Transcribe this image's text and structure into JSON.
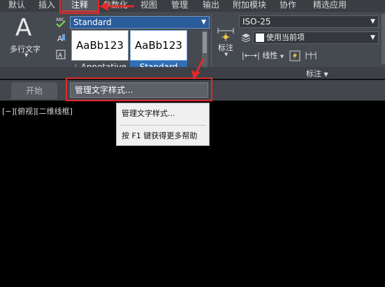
{
  "menubar": {
    "items": [
      "默认",
      "插入",
      "注释",
      "参数化",
      "视图",
      "管理",
      "输出",
      "附加模块",
      "协作",
      "精选应用"
    ],
    "active_index": 2
  },
  "ribbon": {
    "multiline_text_label": "多行文字",
    "text_style_selected": "Standard",
    "text_style_swatches": [
      {
        "preview": "AaBb123",
        "name": "Annotative"
      },
      {
        "preview": "AaBb123",
        "name": "Standard"
      }
    ],
    "dimension_label": "标注",
    "dim_style_selected": "ISO-25",
    "dim_layer_selected": "使用当前项",
    "linear_label": "线性",
    "panel_dimension_title": "标注"
  },
  "tabs": {
    "start_label": "开始",
    "manage_text_styles": "管理文字样式..."
  },
  "viewport": {
    "label": "[−][俯视][二维线框]"
  },
  "context_menu": {
    "items": [
      "管理文字样式...",
      "按 F1 键获得更多帮助"
    ]
  },
  "colors": {
    "ribbon_bg": "#454950",
    "selected_blue": "#2f6fb6",
    "annotation_red": "#e12a2a",
    "viewport_bg": "#000000"
  },
  "icons": [
    "spellcheck-icon",
    "find-text-icon",
    "text-scale-icon",
    "dimension-icon",
    "layer-icon",
    "quick-dimension-icon",
    "continue-dimension-icon"
  ]
}
